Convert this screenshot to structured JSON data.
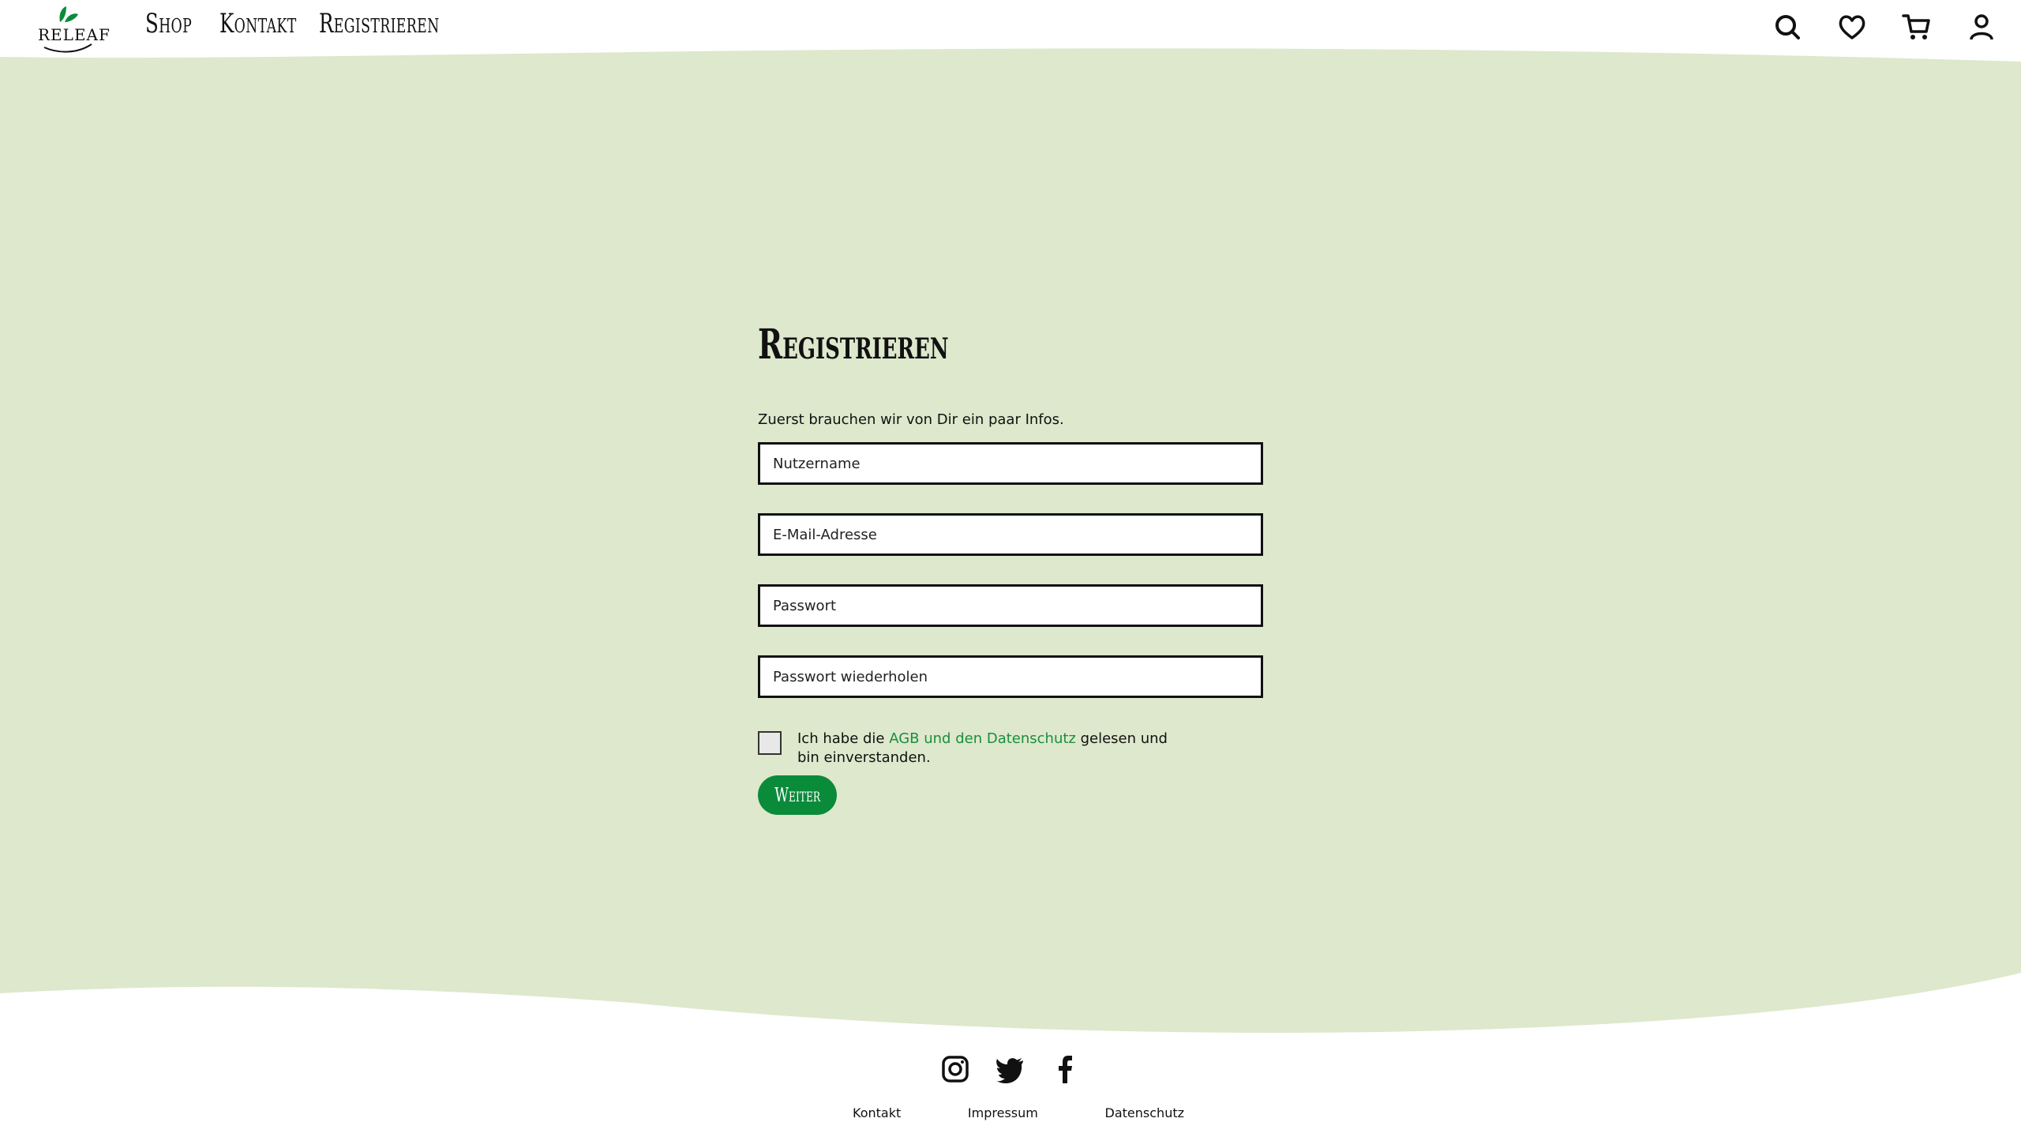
{
  "brand": {
    "name": "RELEAF"
  },
  "nav": {
    "items": [
      {
        "label": "Shop"
      },
      {
        "label": "Kontakt"
      },
      {
        "label": "Registrieren"
      }
    ]
  },
  "header_icons": [
    "search-icon",
    "heart-icon",
    "cart-icon",
    "user-icon"
  ],
  "form": {
    "title": "Registrieren",
    "intro": "Zuerst brauchen wir von Dir ein paar Infos.",
    "fields": {
      "username": {
        "placeholder": "Nutzername",
        "value": ""
      },
      "email": {
        "placeholder": "E-Mail-Adresse",
        "value": ""
      },
      "password": {
        "placeholder": "Passwort",
        "value": ""
      },
      "password_repeat": {
        "placeholder": "Passwort wiederholen",
        "value": ""
      }
    },
    "consent": {
      "before": "Ich habe die ",
      "link": "AGB und den Datenschutz",
      "after": " gelesen und bin einverstanden.",
      "checked": false
    },
    "submit_label": "Weiter"
  },
  "footer": {
    "social": [
      "instagram-icon",
      "twitter-icon",
      "facebook-icon"
    ],
    "links": [
      {
        "label": "Kontakt"
      },
      {
        "label": "Impressum"
      },
      {
        "label": "Datenschutz"
      }
    ]
  },
  "colors": {
    "accent": "#0a8b3a",
    "link": "#1a8f3c",
    "background_band": "#dde8cc"
  }
}
